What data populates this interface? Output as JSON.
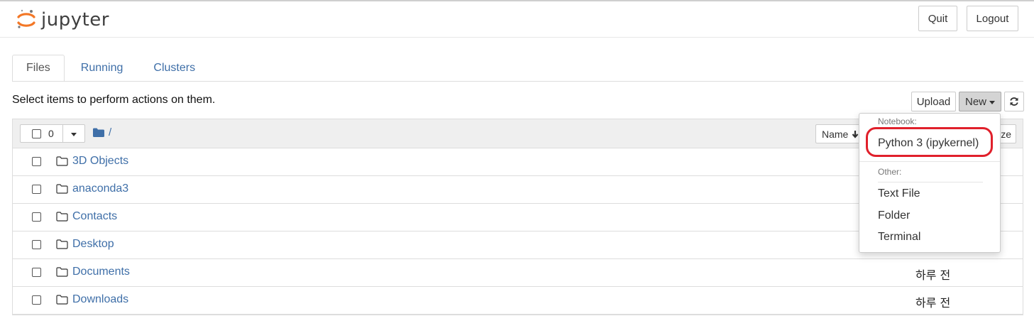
{
  "header": {
    "logo_text": "jupyter",
    "quit_label": "Quit",
    "logout_label": "Logout"
  },
  "tabs": [
    {
      "label": "Files",
      "active": true
    },
    {
      "label": "Running",
      "active": false
    },
    {
      "label": "Clusters",
      "active": false
    }
  ],
  "toolbar": {
    "hint": "Select items to perform actions on them.",
    "upload_label": "Upload",
    "new_label": "New",
    "refresh_icon": "refresh-icon"
  },
  "list_header": {
    "selected_count": "0",
    "breadcrumb_root": "/",
    "sort_name_label": "Name",
    "sort_size_label": "ze"
  },
  "files": [
    {
      "name": "3D Objects",
      "modified": ""
    },
    {
      "name": "anaconda3",
      "modified": ""
    },
    {
      "name": "Contacts",
      "modified": ""
    },
    {
      "name": "Desktop",
      "modified": ""
    },
    {
      "name": "Documents",
      "modified": "하루 전"
    },
    {
      "name": "Downloads",
      "modified": "하루 전"
    }
  ],
  "new_menu": {
    "notebook_header": "Notebook:",
    "kernel_item": "Python 3 (ipykernel)",
    "other_header": "Other:",
    "other_items": [
      "Text File",
      "Folder",
      "Terminal"
    ]
  },
  "colors": {
    "link": "#3f6fa8",
    "logo_orange": "#f37726",
    "highlight": "#e0202b"
  }
}
